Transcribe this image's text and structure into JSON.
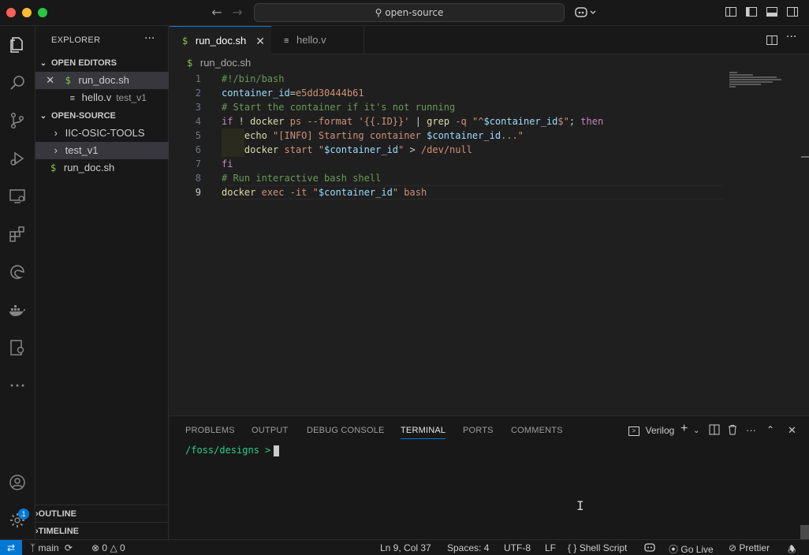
{
  "titlebar": {
    "search_text": "open-source"
  },
  "sidebar": {
    "header": "EXPLORER",
    "open_editors_label": "OPEN EDITORS",
    "open_editors": [
      {
        "name": "run_doc.sh",
        "icon": "shell-icon",
        "description": ""
      },
      {
        "name": "hello.v",
        "icon": "file-lines-icon",
        "description": "test_v1"
      }
    ],
    "workspace_label": "OPEN-SOURCE",
    "tree": [
      {
        "name": "IIC-OSIC-TOOLS",
        "type": "folder"
      },
      {
        "name": "test_v1",
        "type": "folder"
      },
      {
        "name": "run_doc.sh",
        "type": "file"
      }
    ],
    "outline_label": "OUTLINE",
    "timeline_label": "TIMELINE"
  },
  "tabs": [
    {
      "label": "run_doc.sh",
      "active": true
    },
    {
      "label": "hello.v",
      "active": false
    }
  ],
  "breadcrumb": "run_doc.sh",
  "editor": {
    "line_numbers": [
      "1",
      "2",
      "3",
      "4",
      "5",
      "6",
      "7",
      "8",
      "9"
    ],
    "current_line": 9
  },
  "panel": {
    "tabs": [
      "PROBLEMS",
      "OUTPUT",
      "DEBUG CONSOLE",
      "TERMINAL",
      "PORTS",
      "COMMENTS"
    ],
    "active_tab": "TERMINAL",
    "terminal_profile": "Verilog",
    "prompt": "/foss/designs >"
  },
  "statusbar": {
    "branch": "main",
    "errors": "0",
    "warnings": "0",
    "position": "Ln 9, Col 37",
    "spaces": "Spaces: 4",
    "encoding": "UTF-8",
    "eol": "LF",
    "language": "Shell Script",
    "golive": "Go Live",
    "prettier": "Prettier"
  },
  "activity_badge": "1",
  "colors": {
    "accent": "#0078d4",
    "background": "#1f1f1f",
    "sidebar": "#181818"
  }
}
